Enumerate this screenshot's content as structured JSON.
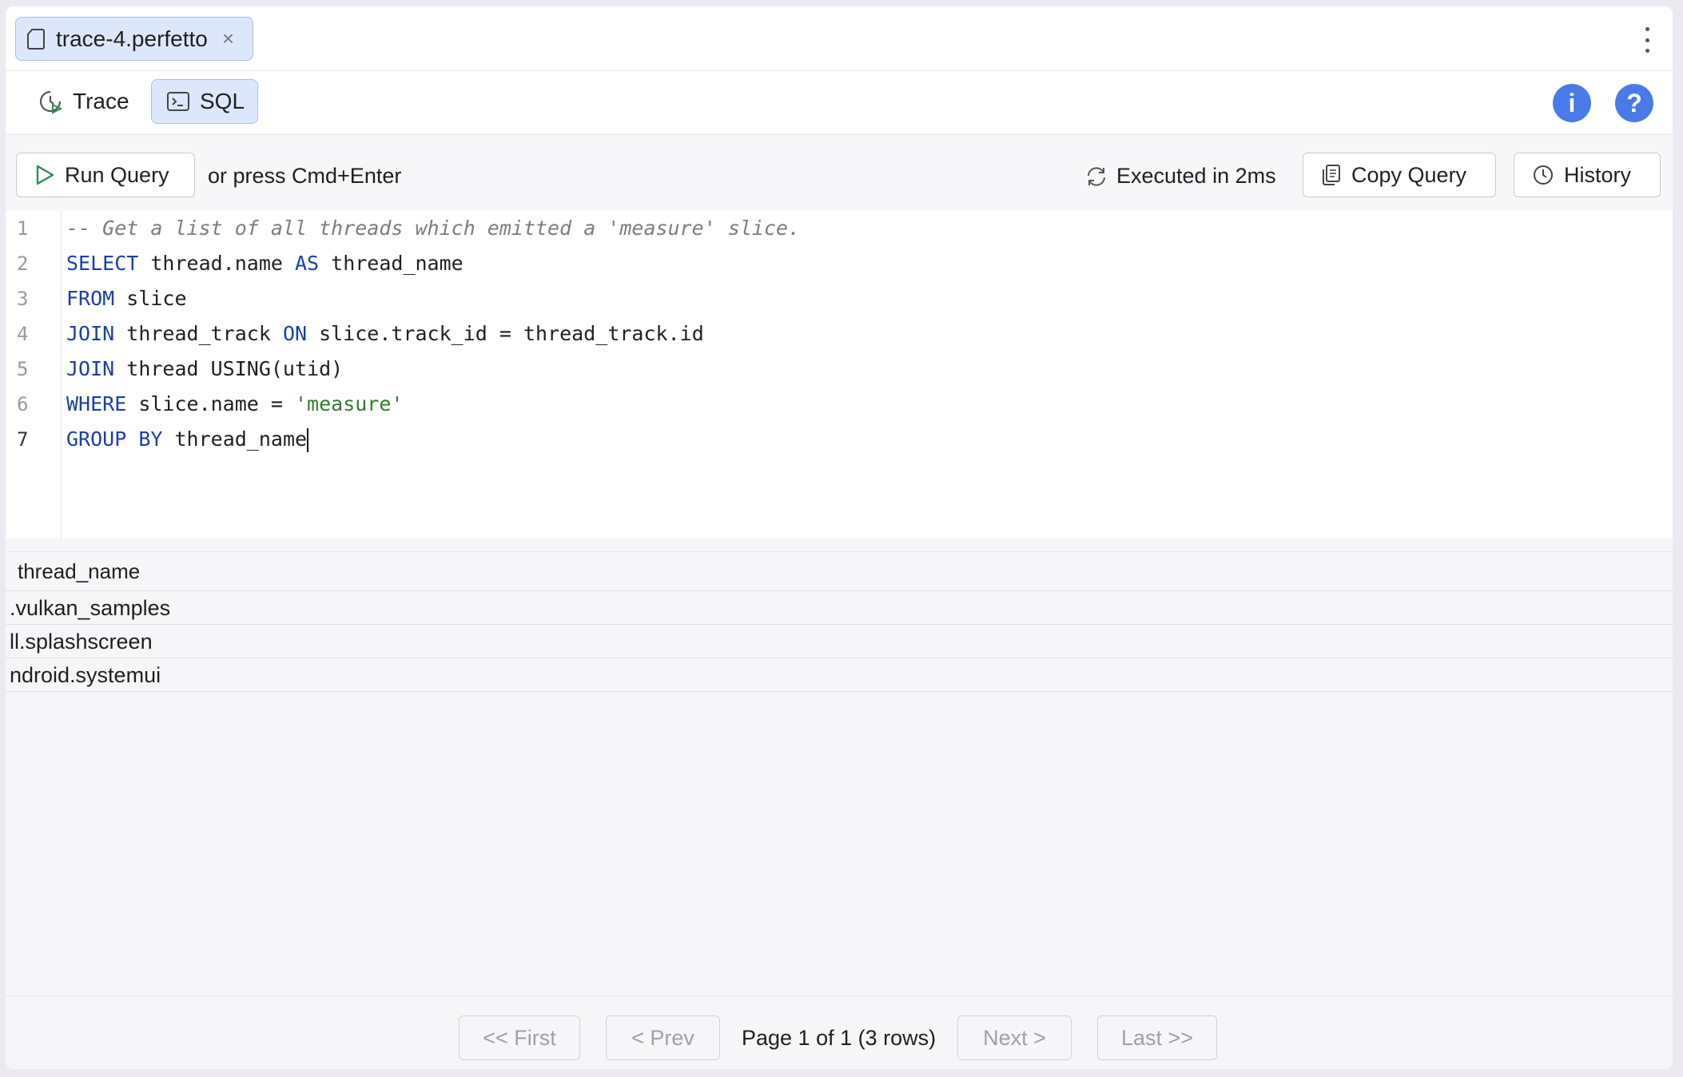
{
  "tab": {
    "file_name": "trace-4.perfetto",
    "close_glyph": "×"
  },
  "modes": {
    "trace_label": "Trace",
    "sql_label": "SQL",
    "info_glyph": "i",
    "help_glyph": "?"
  },
  "toolbar": {
    "run_label": "Run Query",
    "hint": "or press Cmd+Enter",
    "executed": "Executed in 2ms",
    "copy_label": "Copy Query",
    "history_label": "History"
  },
  "editor": {
    "line_numbers": [
      "1",
      "2",
      "3",
      "4",
      "5",
      "6",
      "7"
    ],
    "lines": [
      "-- Get a list of all threads which emitted a 'measure' slice.",
      "SELECT thread.name AS thread_name",
      "FROM slice",
      "JOIN thread_track ON slice.track_id = thread_track.id",
      "JOIN thread USING(utid)",
      "WHERE slice.name = 'measure'",
      "GROUP BY thread_name"
    ]
  },
  "results": {
    "column": "thread_name",
    "rows": [
      ".vulkan_samples",
      "ll.splashscreen",
      "ndroid.systemui"
    ]
  },
  "pager": {
    "first": "<< First",
    "prev": "< Prev",
    "info": "Page 1 of 1 (3 rows)",
    "next": "Next >",
    "last": "Last >>"
  },
  "colors": {
    "accent": "#4a7ae8",
    "selected_bg": "#dde7fb",
    "keyword": "#1a3fa8",
    "string": "#2e7d32"
  }
}
